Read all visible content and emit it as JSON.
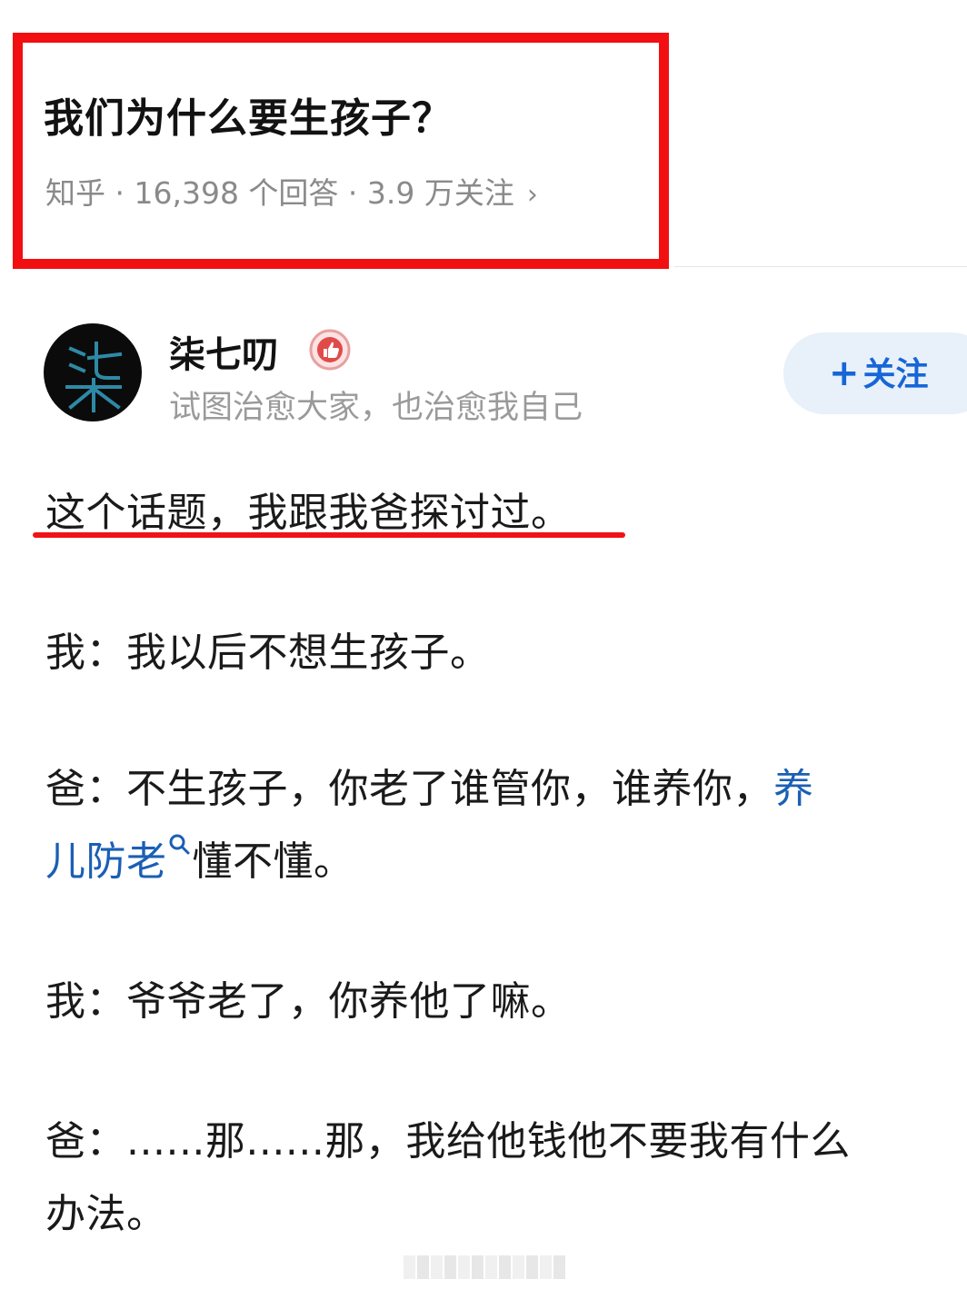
{
  "question": {
    "title": "我们为什么要生孩子？",
    "meta": "知乎 · 16,398 个回答 · 3.9 万关注",
    "chevron": "›"
  },
  "author": {
    "name": "柒七叨",
    "bio": "试图治愈大家，也治愈我自己",
    "avatar_glyph": "柒",
    "badge_icon": "thumbs-up-badge-icon",
    "follow_plus": "+",
    "follow_label": "关注"
  },
  "answer": {
    "p1": "这个话题，我跟我爸探讨过。",
    "p2": "我：我以后不想生孩子。",
    "p3_line1_text": "爸：不生孩子，你老了谁管你，谁养你，",
    "p3_line1_link": "养",
    "p3_line2_link": "儿防老",
    "p3_line2_text": "懂不懂。",
    "p4": "我：爷爷老了，你养他了嘛。",
    "p5_line1": "爸：......那......那，我给他钱他不要我有什么",
    "p5_line2": "办法。"
  },
  "colors": {
    "highlight_red": "#f10f12",
    "link_blue": "#1a5fb4",
    "follow_blue": "#1766d6",
    "follow_bg": "#e8f0fa"
  }
}
